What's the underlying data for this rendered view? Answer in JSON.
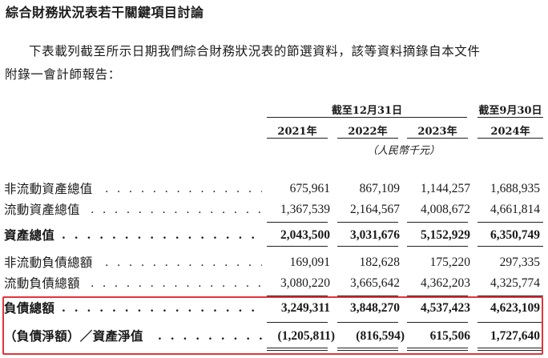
{
  "heading": "綜合財務狀況表若干關鍵項目討論",
  "intro": {
    "line1": "下表載列截至所示日期我們綜合財務狀況表的節選資料，該等資料摘錄自本文件",
    "line2": "附錄一會計師報告："
  },
  "table": {
    "group_header_a": "截至12月31日",
    "group_header_b": "截至9月30日",
    "columns": [
      "2021年",
      "2022年",
      "2023年",
      "2024年"
    ],
    "unit": "（人民幣千元）",
    "dots": ". . . . . . . . . . . . . . . . . . . . . . . . .",
    "rows": [
      {
        "label": "非流動資產總值",
        "values": [
          "675,961",
          "867,109",
          "1,144,257",
          "1,688,935"
        ]
      },
      {
        "label": "流動資產總值",
        "values": [
          "1,367,539",
          "2,164,567",
          "4,008,672",
          "4,661,814"
        ]
      },
      {
        "label": "資產總值",
        "values": [
          "2,043,500",
          "3,031,676",
          "5,152,929",
          "6,350,749"
        ]
      },
      {
        "label": "非流動負債總額",
        "values": [
          "169,091",
          "182,628",
          "175,220",
          "297,335"
        ]
      },
      {
        "label": "流動負債總額",
        "values": [
          "3,080,220",
          "3,665,642",
          "4,362,203",
          "4,325,774"
        ]
      },
      {
        "label": "負債總額",
        "values": [
          "3,249,311",
          "3,848,270",
          "4,537,423",
          "4,623,109"
        ]
      },
      {
        "label": "（負債淨額）／資產淨值",
        "values": [
          "(1,205,811)",
          "(816,594)",
          "615,506",
          "1,727,640"
        ]
      }
    ]
  },
  "highlight_color": "#e0353a"
}
